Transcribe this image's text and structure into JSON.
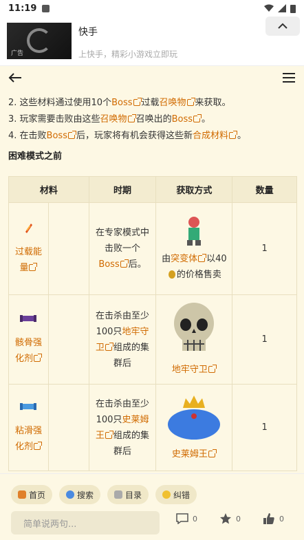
{
  "status_bar": {
    "time": "11:19"
  },
  "ad": {
    "badge": "广告",
    "title": "快手",
    "subtitle": "上快手，精彩小游戏立即玩"
  },
  "content": {
    "line2": {
      "a": "2. 这些材料通过使用10个",
      "boss": "Boss",
      "b": "过载",
      "summon": "召唤物",
      "c": "来获取。"
    },
    "line3": {
      "a": "3. 玩家需要击败由这些",
      "summon": "召唤物",
      "b": "召唤出的",
      "boss": "Boss",
      "c": "。"
    },
    "line4": {
      "a": "4. 在击败",
      "boss": "Boss",
      "b": "后，玩家将有机会获得这些新",
      "craft": "合成材料",
      "c": "。"
    },
    "section_title": "困难模式之前"
  },
  "table": {
    "headers": [
      "材料",
      "时期",
      "获取方式",
      "数量"
    ],
    "rows": [
      {
        "material": "过载能量",
        "period_a": "在专家模式中击败一个",
        "period_link": "Boss",
        "period_b": "后。",
        "obtain_a": "由",
        "obtain_link": "突变体",
        "obtain_b": "以40",
        "obtain_c": "的价格售卖",
        "qty": "1"
      },
      {
        "material": "骸骨强化剂",
        "period_a": "在击杀由至少100只",
        "period_link": "地牢守卫",
        "period_b": "组成的集群后",
        "obtain_link": "地牢守卫",
        "qty": "1"
      },
      {
        "material": "粘滑强化剂",
        "period_a": "在击杀由至少100只",
        "period_link": "史莱姆王",
        "period_b": "组成的集群后",
        "obtain_link": "史莱姆王",
        "qty": "1"
      }
    ]
  },
  "bottom_bar": {
    "pills": [
      "首页",
      "搜索",
      "目录",
      "纠错"
    ],
    "comment_placeholder": "简单说两句...",
    "comments": "0",
    "stars": "0",
    "likes": "0"
  },
  "colors": {
    "link": "#d06a00",
    "background": "#fdf8e4"
  }
}
